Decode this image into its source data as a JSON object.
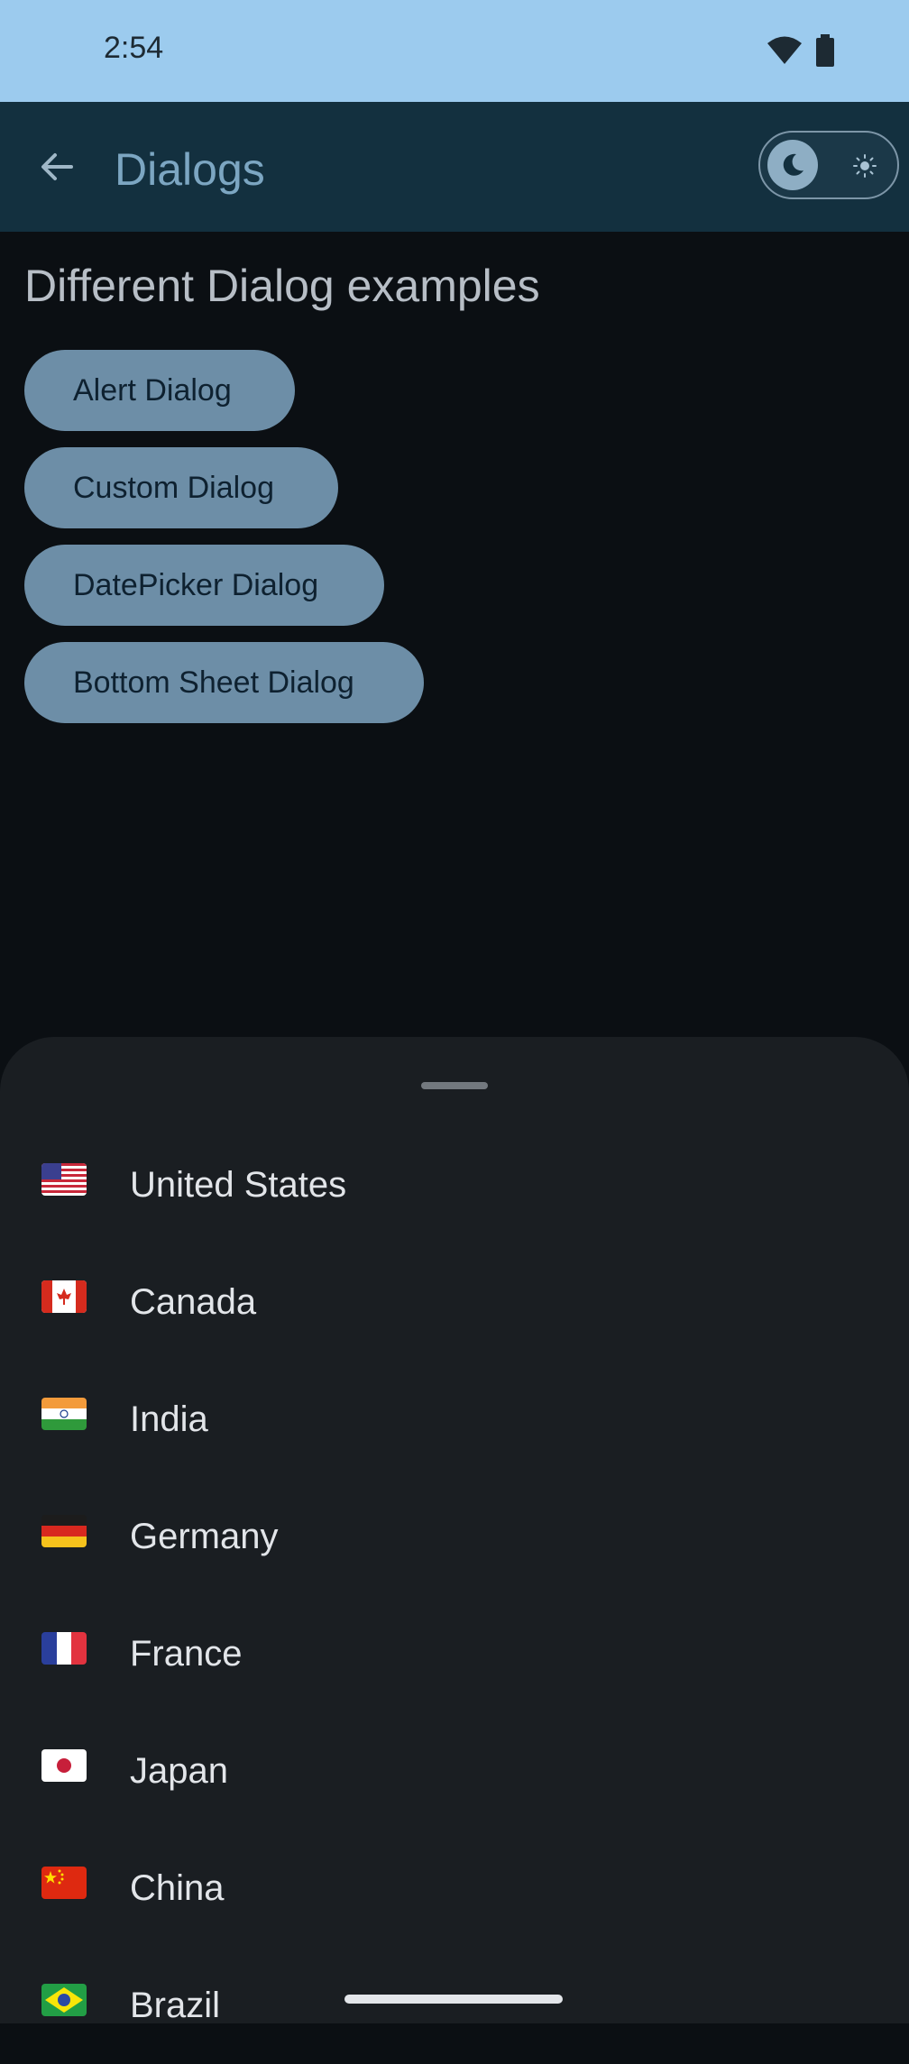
{
  "status_bar": {
    "time": "2:54",
    "icons": [
      "wifi-icon",
      "battery-icon"
    ]
  },
  "app_bar": {
    "title": "Dialogs",
    "back_icon": "arrow-back-icon",
    "theme_toggle": {
      "mode": "dark",
      "icons": [
        "moon-icon",
        "sun-icon"
      ]
    }
  },
  "main": {
    "title": "Different Dialog examples",
    "buttons": [
      "Alert Dialog",
      "Custom Dialog",
      "DatePicker Dialog",
      "Bottom Sheet Dialog"
    ]
  },
  "bottom_sheet": {
    "countries": [
      {
        "name": "United States",
        "flag": "us-flag-icon"
      },
      {
        "name": "Canada",
        "flag": "canada-flag-icon"
      },
      {
        "name": "India",
        "flag": "india-flag-icon"
      },
      {
        "name": "Germany",
        "flag": "germany-flag-icon"
      },
      {
        "name": "France",
        "flag": "france-flag-icon"
      },
      {
        "name": "Japan",
        "flag": "japan-flag-icon"
      },
      {
        "name": "China",
        "flag": "china-flag-icon"
      },
      {
        "name": "Brazil",
        "flag": "brazil-flag-icon"
      }
    ]
  },
  "colors": {
    "status_bar": "#9ccbee",
    "app_bar": "#13303f",
    "background": "#0b0f13",
    "button": "#6d8ea7",
    "sheet": "#1a1e22"
  }
}
